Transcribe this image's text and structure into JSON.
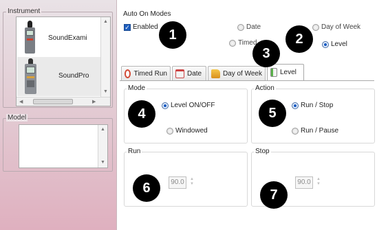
{
  "sidebar": {
    "instrument_label": "Instrument",
    "instruments": [
      {
        "label": "SoundExami"
      },
      {
        "label": "SoundPro"
      }
    ],
    "model_label": "Model"
  },
  "auto_on": {
    "title": "Auto On Modes",
    "enabled_label": "Enabled",
    "enabled_checked": true,
    "modes": [
      {
        "label": "Date",
        "selected": false
      },
      {
        "label": "Day of Week",
        "selected": false
      },
      {
        "label": "Timed",
        "selected": false
      },
      {
        "label": "Level",
        "selected": true
      }
    ]
  },
  "tabs": [
    {
      "label": "Timed Run",
      "icon": "clock-icon",
      "active": false
    },
    {
      "label": "Date",
      "icon": "calendar-icon",
      "active": false
    },
    {
      "label": "Day of Week",
      "icon": "folder-icon",
      "active": false
    },
    {
      "label": "Level",
      "icon": "level-icon",
      "active": true
    }
  ],
  "mode_group": {
    "title": "Mode",
    "options": [
      {
        "label": "Level ON/OFF",
        "selected": true
      },
      {
        "label": "Windowed",
        "selected": false
      }
    ]
  },
  "action_group": {
    "title": "Action",
    "options": [
      {
        "label": "Run / Stop",
        "selected": true
      },
      {
        "label": "Run / Pause",
        "selected": false
      }
    ]
  },
  "run_group": {
    "title": "Run",
    "value": "90.0"
  },
  "stop_group": {
    "title": "Stop",
    "value": "90.0"
  },
  "badges": [
    "1",
    "2",
    "3",
    "4",
    "5",
    "6",
    "7"
  ],
  "colors": {
    "accent": "#1e5fc5",
    "badge": "#000000",
    "sidebar_pink": "#dfb0bf"
  }
}
